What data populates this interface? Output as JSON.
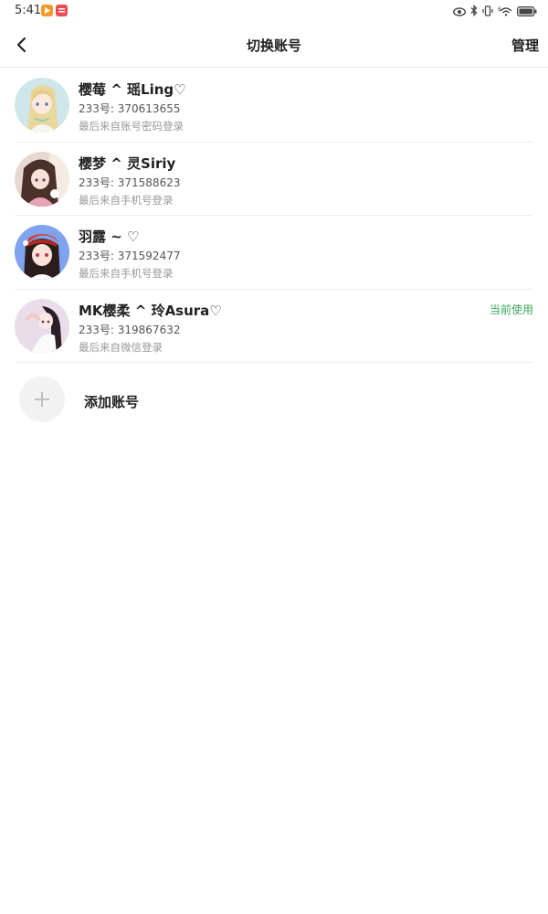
{
  "status_bar": {
    "time": "5:41",
    "network_speed": "6"
  },
  "header": {
    "title": "切换账号",
    "manage_label": "管理"
  },
  "accounts": [
    {
      "name": "樱莓 ^ 瑶Ling♡",
      "id_text": "233号: 370613655",
      "login_text": "最后来自账号密码登录",
      "current": ""
    },
    {
      "name": "樱梦 ^ 灵Siriy",
      "id_text": "233号: 371588623",
      "login_text": "最后来自手机号登录",
      "current": ""
    },
    {
      "name": "羽露 ~ ♡",
      "id_text": "233号: 371592477",
      "login_text": "最后来自手机号登录",
      "current": ""
    },
    {
      "name": "MK樱柔 ^ 玲Asura♡",
      "id_text": "233号: 319867632",
      "login_text": "最后来自微信登录",
      "current": "当前使用"
    }
  ],
  "add_account": {
    "label": "添加账号"
  },
  "colors": {
    "accent_green": "#3aa65a",
    "divider": "#efefef"
  }
}
